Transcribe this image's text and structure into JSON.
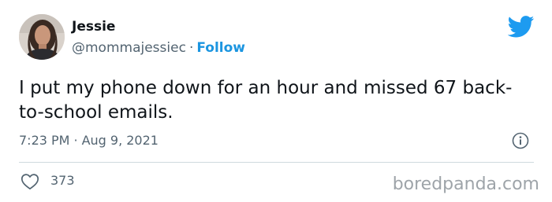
{
  "author": {
    "name": "Jessie",
    "handle": "@mommajessiec",
    "separator": "·",
    "follow_label": "Follow"
  },
  "tweet": {
    "text": "I put my phone down for an hour and missed 67 back-to-school emails.",
    "time": "7:23 PM",
    "separator": "·",
    "date": "Aug 9, 2021"
  },
  "engagement": {
    "likes": "373"
  },
  "watermark": "boredpanda.com",
  "icons": {
    "brand": "twitter-bird-icon",
    "info": "info-icon",
    "like": "heart-icon"
  },
  "colors": {
    "accent": "#1b95e0",
    "muted": "#536471",
    "text": "#0f1419",
    "divider": "#cfd9de"
  }
}
